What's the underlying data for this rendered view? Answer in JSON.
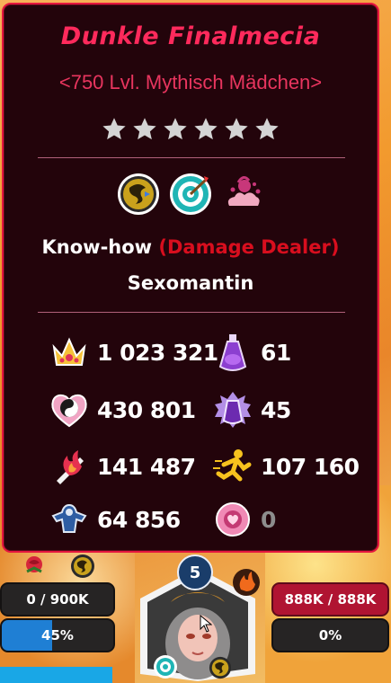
{
  "girl": {
    "name": "Dunkle Finalmecia",
    "subtitle": "<750 Lvl. Mythisch Mädchen>",
    "stars": 6,
    "class_prefix": "Know-how",
    "role": "(Damage Dealer)",
    "job": "Sexomantin"
  },
  "stats": {
    "power": "1 023 321",
    "hardcore": "430 801",
    "charm": "141 487",
    "know_how": "64 856",
    "potion": "61",
    "harmony_potion": "45",
    "speed": "107 160",
    "love": "0"
  },
  "bottom": {
    "affection": "0 / 900K",
    "progress_label": "45%",
    "progress": 0.45,
    "hp": "888K / 888K",
    "hp_percent": "0%",
    "level_badge": "5"
  },
  "icons": {
    "star": "star-icon",
    "element": "know-how-element-icon",
    "role": "target-role-icon",
    "skill": "splash-skill-icon"
  },
  "colors": {
    "accent": "#ff2a5c",
    "role": "#d80e1e",
    "card_bg": "#23040b",
    "border": "#e4163f"
  }
}
